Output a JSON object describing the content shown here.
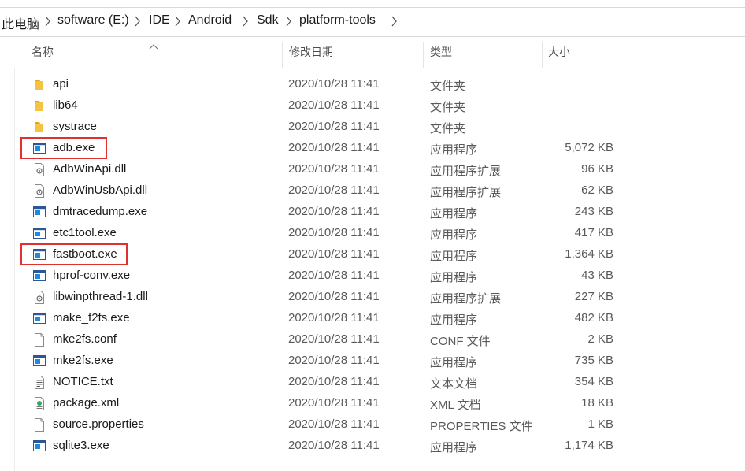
{
  "breadcrumb": [
    "此电脑",
    "software (E:)",
    "IDE",
    "Android",
    "Sdk",
    "platform-tools"
  ],
  "columns": {
    "name": "名称",
    "date": "修改日期",
    "type": "类型",
    "size": "大小"
  },
  "files": [
    {
      "name": "api",
      "date": "2020/10/28 11:41",
      "type": "文件夹",
      "size": "",
      "icon": "folder-icon"
    },
    {
      "name": "lib64",
      "date": "2020/10/28 11:41",
      "type": "文件夹",
      "size": "",
      "icon": "folder-icon"
    },
    {
      "name": "systrace",
      "date": "2020/10/28 11:41",
      "type": "文件夹",
      "size": "",
      "icon": "folder-icon"
    },
    {
      "name": "adb.exe",
      "date": "2020/10/28 11:41",
      "type": "应用程序",
      "size": "5,072 KB",
      "icon": "exe-icon",
      "highlighted": true
    },
    {
      "name": "AdbWinApi.dll",
      "date": "2020/10/28 11:41",
      "type": "应用程序扩展",
      "size": "96 KB",
      "icon": "dll-icon"
    },
    {
      "name": "AdbWinUsbApi.dll",
      "date": "2020/10/28 11:41",
      "type": "应用程序扩展",
      "size": "62 KB",
      "icon": "dll-icon"
    },
    {
      "name": "dmtracedump.exe",
      "date": "2020/10/28 11:41",
      "type": "应用程序",
      "size": "243 KB",
      "icon": "exe-icon"
    },
    {
      "name": "etc1tool.exe",
      "date": "2020/10/28 11:41",
      "type": "应用程序",
      "size": "417 KB",
      "icon": "exe-icon"
    },
    {
      "name": "fastboot.exe",
      "date": "2020/10/28 11:41",
      "type": "应用程序",
      "size": "1,364 KB",
      "icon": "exe-icon",
      "highlighted": true
    },
    {
      "name": "hprof-conv.exe",
      "date": "2020/10/28 11:41",
      "type": "应用程序",
      "size": "43 KB",
      "icon": "exe-icon"
    },
    {
      "name": "libwinpthread-1.dll",
      "date": "2020/10/28 11:41",
      "type": "应用程序扩展",
      "size": "227 KB",
      "icon": "dll-icon"
    },
    {
      "name": "make_f2fs.exe",
      "date": "2020/10/28 11:41",
      "type": "应用程序",
      "size": "482 KB",
      "icon": "exe-icon"
    },
    {
      "name": "mke2fs.conf",
      "date": "2020/10/28 11:41",
      "type": "CONF 文件",
      "size": "2 KB",
      "icon": "file-icon"
    },
    {
      "name": "mke2fs.exe",
      "date": "2020/10/28 11:41",
      "type": "应用程序",
      "size": "735 KB",
      "icon": "exe-icon"
    },
    {
      "name": "NOTICE.txt",
      "date": "2020/10/28 11:41",
      "type": "文本文档",
      "size": "354 KB",
      "icon": "text-file-icon"
    },
    {
      "name": "package.xml",
      "date": "2020/10/28 11:41",
      "type": "XML 文档",
      "size": "18 KB",
      "icon": "xml-file-icon"
    },
    {
      "name": "source.properties",
      "date": "2020/10/28 11:41",
      "type": "PROPERTIES 文件",
      "size": "1 KB",
      "icon": "file-icon"
    },
    {
      "name": "sqlite3.exe",
      "date": "2020/10/28 11:41",
      "type": "应用程序",
      "size": "1,174 KB",
      "icon": "exe-icon"
    }
  ],
  "colors": {
    "highlight": "#e03131",
    "folder": "#f3c344",
    "exe_blue": "#1565c0"
  }
}
